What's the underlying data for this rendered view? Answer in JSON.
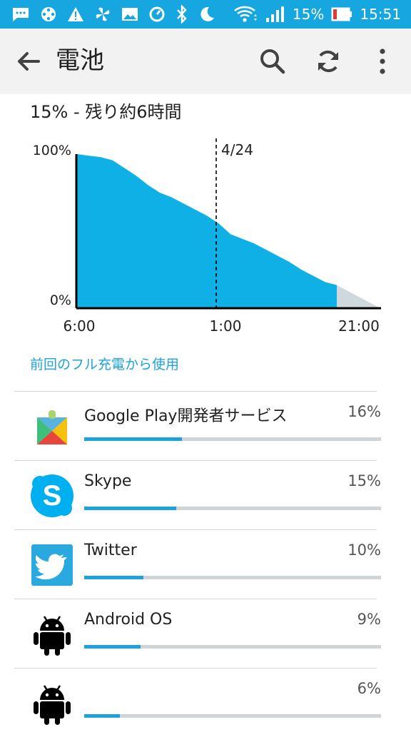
{
  "status_bar": {
    "battery_percent": "15%",
    "time": "15:51"
  },
  "app_bar": {
    "title": "電池"
  },
  "summary": "15% - 残り約6時間",
  "chart_data": {
    "type": "area",
    "y_labels": [
      "100%",
      "0%"
    ],
    "x_labels": [
      "6:00",
      "1:00",
      "21:00"
    ],
    "marker_label": "4/24",
    "series": [
      {
        "values": [
          100,
          99,
          98,
          96,
          91,
          86,
          80,
          75,
          72,
          68,
          64,
          60,
          55,
          48,
          45,
          42,
          38,
          34,
          30,
          25,
          21,
          17,
          15
        ]
      },
      {
        "values": [
          15,
          0
        ]
      }
    ],
    "ylim": [
      0,
      100
    ],
    "colors": {
      "used": "#0fb0e6",
      "projected": "#cfd8dc"
    }
  },
  "section_title": "前回のフル充電から使用",
  "apps": [
    {
      "name": "Google Play開発者サービス",
      "percent": "16%",
      "usage": 0.33,
      "icon": "google-play-services-icon"
    },
    {
      "name": "Skype",
      "percent": "15%",
      "usage": 0.31,
      "icon": "skype-icon"
    },
    {
      "name": "Twitter",
      "percent": "10%",
      "usage": 0.2,
      "icon": "twitter-icon"
    },
    {
      "name": "Android OS",
      "percent": "9%",
      "usage": 0.19,
      "icon": "android-icon"
    },
    {
      "name": "",
      "percent": "6%",
      "usage": 0.12,
      "icon": "android-icon"
    }
  ]
}
